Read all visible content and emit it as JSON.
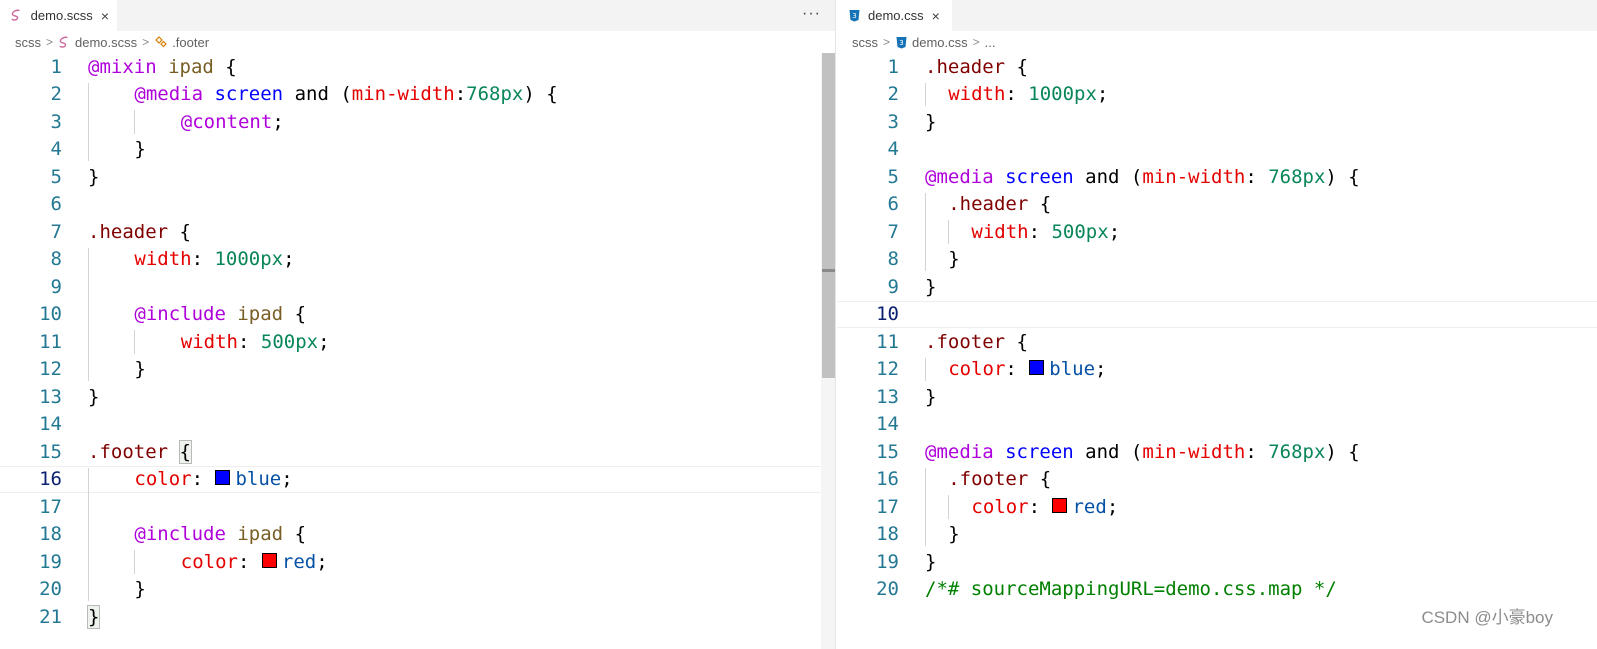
{
  "left_editor": {
    "tab_label": "demo.scss",
    "tab_close": "×",
    "more_actions": "···",
    "breadcrumb": [
      "scss",
      "demo.scss",
      ".footer"
    ],
    "lines": [
      {
        "n": "1",
        "indent": 0,
        "tokens": [
          [
            "@mixin",
            "at"
          ],
          [
            " ",
            "plain"
          ],
          [
            "ipad",
            "name"
          ],
          [
            " {",
            "plain"
          ]
        ]
      },
      {
        "n": "2",
        "indent": 4,
        "tokens": [
          [
            "@media",
            "at"
          ],
          [
            " ",
            "plain"
          ],
          [
            "screen",
            "kw"
          ],
          [
            " and (",
            "plain"
          ],
          [
            "min-width",
            "prop"
          ],
          [
            ":",
            "plain"
          ],
          [
            "768px",
            "num"
          ],
          [
            ") {",
            "plain"
          ]
        ]
      },
      {
        "n": "3",
        "indent": 8,
        "tokens": [
          [
            "@content",
            "at"
          ],
          [
            ";",
            "plain"
          ]
        ]
      },
      {
        "n": "4",
        "indent": 4,
        "tokens": [
          [
            "}",
            "plain"
          ]
        ]
      },
      {
        "n": "5",
        "indent": 0,
        "tokens": [
          [
            "}",
            "plain"
          ]
        ]
      },
      {
        "n": "6",
        "indent": 0,
        "tokens": []
      },
      {
        "n": "7",
        "indent": 0,
        "tokens": [
          [
            ".header",
            "sel"
          ],
          [
            " {",
            "plain"
          ]
        ]
      },
      {
        "n": "8",
        "indent": 4,
        "tokens": [
          [
            "width",
            "prop"
          ],
          [
            ": ",
            "plain"
          ],
          [
            "1000px",
            "num"
          ],
          [
            ";",
            "plain"
          ]
        ]
      },
      {
        "n": "9",
        "indent": 0,
        "tokens": []
      },
      {
        "n": "10",
        "indent": 4,
        "tokens": [
          [
            "@include",
            "at"
          ],
          [
            " ",
            "plain"
          ],
          [
            "ipad",
            "name"
          ],
          [
            " {",
            "plain"
          ]
        ]
      },
      {
        "n": "11",
        "indent": 8,
        "tokens": [
          [
            "width",
            "prop"
          ],
          [
            ": ",
            "plain"
          ],
          [
            "500px",
            "num"
          ],
          [
            ";",
            "plain"
          ]
        ]
      },
      {
        "n": "12",
        "indent": 4,
        "tokens": [
          [
            "}",
            "plain"
          ]
        ]
      },
      {
        "n": "13",
        "indent": 0,
        "tokens": [
          [
            "}",
            "plain"
          ]
        ]
      },
      {
        "n": "14",
        "indent": 0,
        "tokens": []
      },
      {
        "n": "15",
        "indent": 0,
        "tokens": [
          [
            ".footer",
            "sel"
          ],
          [
            " ",
            "plain"
          ],
          [
            "{",
            "bracehl"
          ]
        ]
      },
      {
        "n": "16",
        "indent": 4,
        "current": true,
        "tokens": [
          [
            "color",
            "prop"
          ],
          [
            ": ",
            "plain"
          ],
          [
            "",
            "swatch-blue"
          ],
          [
            "blue",
            "val"
          ],
          [
            ";",
            "plain"
          ]
        ]
      },
      {
        "n": "17",
        "indent": 0,
        "tokens": []
      },
      {
        "n": "18",
        "indent": 4,
        "tokens": [
          [
            "@include",
            "at"
          ],
          [
            " ",
            "plain"
          ],
          [
            "ipad",
            "name"
          ],
          [
            " {",
            "plain"
          ]
        ]
      },
      {
        "n": "19",
        "indent": 8,
        "tokens": [
          [
            "color",
            "prop"
          ],
          [
            ": ",
            "plain"
          ],
          [
            "",
            "swatch-red"
          ],
          [
            "red",
            "val"
          ],
          [
            ";",
            "plain"
          ]
        ]
      },
      {
        "n": "20",
        "indent": 4,
        "tokens": [
          [
            "}",
            "plain"
          ]
        ]
      },
      {
        "n": "21",
        "indent": 0,
        "tokens": [
          [
            "}",
            "bracehl"
          ]
        ]
      }
    ]
  },
  "right_editor": {
    "tab_label": "demo.css",
    "tab_close": "×",
    "breadcrumb": [
      "scss",
      "demo.css",
      "..."
    ],
    "lines": [
      {
        "n": "1",
        "indent": 0,
        "tokens": [
          [
            ".header",
            "sel"
          ],
          [
            " {",
            "plain"
          ]
        ]
      },
      {
        "n": "2",
        "indent": 2,
        "tokens": [
          [
            "width",
            "prop"
          ],
          [
            ": ",
            "plain"
          ],
          [
            "1000px",
            "num"
          ],
          [
            ";",
            "plain"
          ]
        ]
      },
      {
        "n": "3",
        "indent": 0,
        "tokens": [
          [
            "}",
            "plain"
          ]
        ]
      },
      {
        "n": "4",
        "indent": 0,
        "tokens": []
      },
      {
        "n": "5",
        "indent": 0,
        "tokens": [
          [
            "@media",
            "at"
          ],
          [
            " ",
            "plain"
          ],
          [
            "screen",
            "kw"
          ],
          [
            " and (",
            "plain"
          ],
          [
            "min-width",
            "prop"
          ],
          [
            ": ",
            "plain"
          ],
          [
            "768px",
            "num"
          ],
          [
            ") {",
            "plain"
          ]
        ]
      },
      {
        "n": "6",
        "indent": 2,
        "tokens": [
          [
            ".header",
            "sel"
          ],
          [
            " {",
            "plain"
          ]
        ]
      },
      {
        "n": "7",
        "indent": 4,
        "tokens": [
          [
            "width",
            "prop"
          ],
          [
            ": ",
            "plain"
          ],
          [
            "500px",
            "num"
          ],
          [
            ";",
            "plain"
          ]
        ]
      },
      {
        "n": "8",
        "indent": 2,
        "tokens": [
          [
            "}",
            "plain"
          ]
        ]
      },
      {
        "n": "9",
        "indent": 0,
        "tokens": [
          [
            "}",
            "plain"
          ]
        ]
      },
      {
        "n": "10",
        "indent": 0,
        "current": true,
        "tokens": []
      },
      {
        "n": "11",
        "indent": 0,
        "tokens": [
          [
            ".footer",
            "sel"
          ],
          [
            " {",
            "plain"
          ]
        ]
      },
      {
        "n": "12",
        "indent": 2,
        "tokens": [
          [
            "color",
            "prop"
          ],
          [
            ": ",
            "plain"
          ],
          [
            "",
            "swatch-blue"
          ],
          [
            "blue",
            "val"
          ],
          [
            ";",
            "plain"
          ]
        ]
      },
      {
        "n": "13",
        "indent": 0,
        "tokens": [
          [
            "}",
            "plain"
          ]
        ]
      },
      {
        "n": "14",
        "indent": 0,
        "tokens": []
      },
      {
        "n": "15",
        "indent": 0,
        "tokens": [
          [
            "@media",
            "at"
          ],
          [
            " ",
            "plain"
          ],
          [
            "screen",
            "kw"
          ],
          [
            " and (",
            "plain"
          ],
          [
            "min-width",
            "prop"
          ],
          [
            ": ",
            "plain"
          ],
          [
            "768px",
            "num"
          ],
          [
            ") {",
            "plain"
          ]
        ]
      },
      {
        "n": "16",
        "indent": 2,
        "tokens": [
          [
            ".footer",
            "sel"
          ],
          [
            " {",
            "plain"
          ]
        ]
      },
      {
        "n": "17",
        "indent": 4,
        "tokens": [
          [
            "color",
            "prop"
          ],
          [
            ": ",
            "plain"
          ],
          [
            "",
            "swatch-red"
          ],
          [
            "red",
            "val"
          ],
          [
            ";",
            "plain"
          ]
        ]
      },
      {
        "n": "18",
        "indent": 2,
        "tokens": [
          [
            "}",
            "plain"
          ]
        ]
      },
      {
        "n": "19",
        "indent": 0,
        "tokens": [
          [
            "}",
            "plain"
          ]
        ]
      },
      {
        "n": "20",
        "indent": 0,
        "tokens": [
          [
            "/*# sourceMappingURL=demo.css.map */",
            "com"
          ]
        ]
      }
    ]
  },
  "colors": {
    "swatch_blue": "#0000ff",
    "swatch_red": "#ff0000",
    "scss_icon": "#cd6799",
    "css_icon": "#1572b6",
    "symbol_icon": "#d67e00"
  },
  "watermark": "CSDN @小豪boy"
}
